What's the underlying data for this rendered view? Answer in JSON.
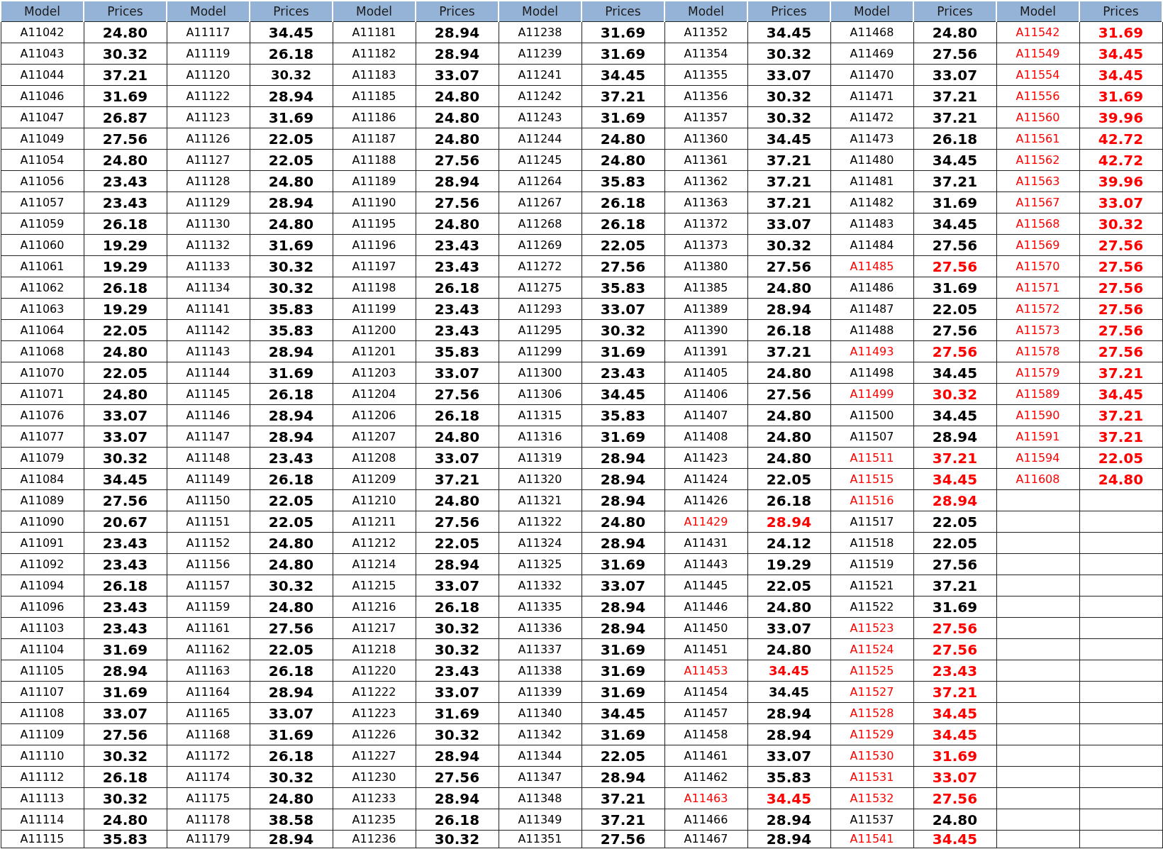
{
  "header": [
    "Model",
    "Prices",
    "Model",
    "Prices",
    "Model",
    "Prices",
    "Model",
    "Prices",
    "Model",
    "Prices",
    "Model",
    "Prices",
    "Model",
    "Prices"
  ],
  "column_groups": [
    {
      "entries": [
        {
          "model": "A11042",
          "price": "24.80",
          "color": "#000000",
          "large": true
        },
        {
          "model": "A11043",
          "price": "30.32",
          "color": "#000000",
          "large": true
        },
        {
          "model": "A11044",
          "price": "37.21",
          "color": "#000000",
          "large": true
        },
        {
          "model": "A11046",
          "price": "31.69",
          "color": "#000000",
          "large": true
        },
        {
          "model": "A11047",
          "price": "26.87",
          "color": "#000000",
          "large": true
        },
        {
          "model": "A11049",
          "price": "27.56",
          "color": "#000000",
          "large": true
        },
        {
          "model": "A11054",
          "price": "24.80",
          "color": "#000000",
          "large": true
        },
        {
          "model": "A11056",
          "price": "23.43",
          "color": "#000000",
          "large": true
        },
        {
          "model": "A11057",
          "price": "23.43",
          "color": "#000000",
          "large": true
        },
        {
          "model": "A11059",
          "price": "26.18",
          "color": "#000000",
          "large": true
        },
        {
          "model": "A11060",
          "price": "19.29",
          "color": "#000000",
          "large": true
        },
        {
          "model": "A11061",
          "price": "19.29",
          "color": "#000000",
          "large": true
        },
        {
          "model": "A11062",
          "price": "26.18",
          "color": "#000000",
          "large": true
        },
        {
          "model": "A11063",
          "price": "19.29",
          "color": "#000000",
          "large": true
        },
        {
          "model": "A11064",
          "price": "22.05",
          "color": "#000000",
          "large": true
        },
        {
          "model": "A11068",
          "price": "24.80",
          "color": "#000000",
          "large": true
        },
        {
          "model": "A11070",
          "price": "22.05",
          "color": "#000000",
          "large": true
        },
        {
          "model": "A11071",
          "price": "24.80",
          "color": "#000000",
          "large": true
        },
        {
          "model": "A11076",
          "price": "33.07",
          "color": "#000000",
          "large": true
        },
        {
          "model": "A11077",
          "price": "33.07",
          "color": "#000000",
          "large": true
        },
        {
          "model": "A11079",
          "price": "30.32",
          "color": "#000000",
          "large": true
        },
        {
          "model": "A11084",
          "price": "34.45",
          "color": "#000000",
          "large": true
        },
        {
          "model": "A11089",
          "price": "27.56",
          "color": "#000000",
          "large": true
        },
        {
          "model": "A11090",
          "price": "20.67",
          "color": "#000000",
          "large": true
        },
        {
          "model": "A11091",
          "price": "23.43",
          "color": "#000000",
          "large": true
        },
        {
          "model": "A11092",
          "price": "23.43",
          "color": "#000000",
          "large": true
        },
        {
          "model": "A11094",
          "price": "26.18",
          "color": "#000000",
          "large": true
        },
        {
          "model": "A11096",
          "price": "23.43",
          "color": "#000000",
          "large": true
        },
        {
          "model": "A11103",
          "price": "23.43",
          "color": "#000000",
          "large": true
        },
        {
          "model": "A11104",
          "price": "31.69",
          "color": "#000000",
          "large": true
        },
        {
          "model": "A11105",
          "price": "28.94",
          "color": "#000000",
          "large": true
        },
        {
          "model": "A11107",
          "price": "31.69",
          "color": "#000000",
          "large": true
        },
        {
          "model": "A11108",
          "price": "33.07",
          "color": "#000000",
          "large": true
        },
        {
          "model": "A11109",
          "price": "27.56",
          "color": "#000000",
          "large": true
        },
        {
          "model": "A11110",
          "price": "30.32",
          "color": "#000000",
          "large": true
        },
        {
          "model": "A11112",
          "price": "26.18",
          "color": "#000000",
          "large": true
        },
        {
          "model": "A11113",
          "price": "30.32",
          "color": "#000000",
          "large": true
        },
        {
          "model": "A11114",
          "price": "24.80",
          "color": "#000000",
          "large": true
        },
        {
          "model": "A11115",
          "price": "35.83",
          "color": "#000000",
          "large": true
        }
      ]
    },
    {
      "entries": [
        {
          "model": "A11117",
          "price": "34.45",
          "color": "#000000",
          "large": true
        },
        {
          "model": "A11119",
          "price": "26.18",
          "color": "#000000",
          "large": true
        },
        {
          "model": "A11120",
          "price": "30.32",
          "color": "#000000",
          "large": false
        },
        {
          "model": "A11122",
          "price": "28.94",
          "color": "#000000",
          "large": true
        },
        {
          "model": "A11123",
          "price": "31.69",
          "color": "#000000",
          "large": true
        },
        {
          "model": "A11126",
          "price": "22.05",
          "color": "#000000",
          "large": true
        },
        {
          "model": "A11127",
          "price": "22.05",
          "color": "#000000",
          "large": true
        },
        {
          "model": "A11128",
          "price": "24.80",
          "color": "#000000",
          "large": true
        },
        {
          "model": "A11129",
          "price": "28.94",
          "color": "#000000",
          "large": true
        },
        {
          "model": "A11130",
          "price": "24.80",
          "color": "#000000",
          "large": true
        },
        {
          "model": "A11132",
          "price": "31.69",
          "color": "#000000",
          "large": true
        },
        {
          "model": "A11133",
          "price": "30.32",
          "color": "#000000",
          "large": true
        },
        {
          "model": "A11134",
          "price": "30.32",
          "color": "#000000",
          "large": true
        },
        {
          "model": "A11141",
          "price": "35.83",
          "color": "#000000",
          "large": true
        },
        {
          "model": "A11142",
          "price": "35.83",
          "color": "#000000",
          "large": true
        },
        {
          "model": "A11143",
          "price": "28.94",
          "color": "#000000",
          "large": true
        },
        {
          "model": "A11144",
          "price": "31.69",
          "color": "#000000",
          "large": true
        },
        {
          "model": "A11145",
          "price": "26.18",
          "color": "#000000",
          "large": true
        },
        {
          "model": "A11146",
          "price": "28.94",
          "color": "#000000",
          "large": true
        },
        {
          "model": "A11147",
          "price": "28.94",
          "color": "#000000",
          "large": true
        },
        {
          "model": "A11148",
          "price": "23.43",
          "color": "#000000",
          "large": true
        },
        {
          "model": "A11149",
          "price": "26.18",
          "color": "#000000",
          "large": true
        },
        {
          "model": "A11150",
          "price": "22.05",
          "color": "#000000",
          "large": true
        },
        {
          "model": "A11151",
          "price": "22.05",
          "color": "#000000",
          "large": true
        },
        {
          "model": "A11152",
          "price": "24.80",
          "color": "#000000",
          "large": true
        },
        {
          "model": "A11156",
          "price": "24.80",
          "color": "#000000",
          "large": true
        },
        {
          "model": "A11157",
          "price": "30.32",
          "color": "#000000",
          "large": true
        },
        {
          "model": "A11159",
          "price": "24.80",
          "color": "#000000",
          "large": true
        },
        {
          "model": "A11161",
          "price": "27.56",
          "color": "#000000",
          "large": true
        },
        {
          "model": "A11162",
          "price": "22.05",
          "color": "#000000",
          "large": true
        },
        {
          "model": "A11163",
          "price": "26.18",
          "color": "#000000",
          "large": true
        },
        {
          "model": "A11164",
          "price": "28.94",
          "color": "#000000",
          "large": true
        },
        {
          "model": "A11165",
          "price": "33.07",
          "color": "#000000",
          "large": true
        },
        {
          "model": "A11168",
          "price": "31.69",
          "color": "#000000",
          "large": true
        },
        {
          "model": "A11172",
          "price": "26.18",
          "color": "#000000",
          "large": true
        },
        {
          "model": "A11174",
          "price": "30.32",
          "color": "#000000",
          "large": true
        },
        {
          "model": "A11175",
          "price": "24.80",
          "color": "#000000",
          "large": true
        },
        {
          "model": "A11178",
          "price": "38.58",
          "color": "#000000",
          "large": true
        },
        {
          "model": "A11179",
          "price": "28.94",
          "color": "#000000",
          "large": true
        }
      ]
    },
    {
      "entries": [
        {
          "model": "A11181",
          "price": "28.94",
          "color": "#000000",
          "large": true
        },
        {
          "model": "A11182",
          "price": "28.94",
          "color": "#000000",
          "large": true
        },
        {
          "model": "A11183",
          "price": "33.07",
          "color": "#000000",
          "large": true
        },
        {
          "model": "A11185",
          "price": "24.80",
          "color": "#000000",
          "large": true
        },
        {
          "model": "A11186",
          "price": "24.80",
          "color": "#000000",
          "large": true
        },
        {
          "model": "A11187",
          "price": "24.80",
          "color": "#000000",
          "large": true
        },
        {
          "model": "A11188",
          "price": "27.56",
          "color": "#000000",
          "large": true
        },
        {
          "model": "A11189",
          "price": "28.94",
          "color": "#000000",
          "large": true
        },
        {
          "model": "A11190",
          "price": "27.56",
          "color": "#000000",
          "large": true
        },
        {
          "model": "A11195",
          "price": "24.80",
          "color": "#000000",
          "large": true
        },
        {
          "model": "A11196",
          "price": "23.43",
          "color": "#000000",
          "large": true
        },
        {
          "model": "A11197",
          "price": "23.43",
          "color": "#000000",
          "large": true
        },
        {
          "model": "A11198",
          "price": "26.18",
          "color": "#000000",
          "large": true
        },
        {
          "model": "A11199",
          "price": "23.43",
          "color": "#000000",
          "large": true
        },
        {
          "model": "A11200",
          "price": "23.43",
          "color": "#000000",
          "large": true
        },
        {
          "model": "A11201",
          "price": "35.83",
          "color": "#000000",
          "large": true
        },
        {
          "model": "A11203",
          "price": "33.07",
          "color": "#000000",
          "large": true
        },
        {
          "model": "A11204",
          "price": "27.56",
          "color": "#000000",
          "large": true
        },
        {
          "model": "A11206",
          "price": "26.18",
          "color": "#000000",
          "large": true
        },
        {
          "model": "A11207",
          "price": "24.80",
          "color": "#000000",
          "large": true
        },
        {
          "model": "A11208",
          "price": "33.07",
          "color": "#000000",
          "large": true
        },
        {
          "model": "A11209",
          "price": "37.21",
          "color": "#000000",
          "large": true
        },
        {
          "model": "A11210",
          "price": "24.80",
          "color": "#000000",
          "large": true
        },
        {
          "model": "A11211",
          "price": "27.56",
          "color": "#000000",
          "large": true
        },
        {
          "model": "A11212",
          "price": "22.05",
          "color": "#000000",
          "large": true
        },
        {
          "model": "A11214",
          "price": "28.94",
          "color": "#000000",
          "large": true
        },
        {
          "model": "A11215",
          "price": "33.07",
          "color": "#000000",
          "large": true
        },
        {
          "model": "A11216",
          "price": "26.18",
          "color": "#000000",
          "large": true
        },
        {
          "model": "A11217",
          "price": "30.32",
          "color": "#000000",
          "large": true
        },
        {
          "model": "A11218",
          "price": "30.32",
          "color": "#000000",
          "large": true
        },
        {
          "model": "A11220",
          "price": "23.43",
          "color": "#000000",
          "large": true
        },
        {
          "model": "A11222",
          "price": "33.07",
          "color": "#000000",
          "large": true
        },
        {
          "model": "A11223",
          "price": "31.69",
          "color": "#000000",
          "large": true
        },
        {
          "model": "A11226",
          "price": "30.32",
          "color": "#000000",
          "large": true
        },
        {
          "model": "A11227",
          "price": "28.94",
          "color": "#000000",
          "large": true
        },
        {
          "model": "A11230",
          "price": "27.56",
          "color": "#000000",
          "large": true
        },
        {
          "model": "A11233",
          "price": "28.94",
          "color": "#000000",
          "large": true
        },
        {
          "model": "A11235",
          "price": "26.18",
          "color": "#000000",
          "large": true
        },
        {
          "model": "A11236",
          "price": "30.32",
          "color": "#000000",
          "large": true
        }
      ]
    },
    {
      "entries": [
        {
          "model": "A11238",
          "price": "31.69",
          "color": "#000000",
          "large": true
        },
        {
          "model": "A11239",
          "price": "31.69",
          "color": "#000000",
          "large": true
        },
        {
          "model": "A11241",
          "price": "34.45",
          "color": "#000000",
          "large": true
        },
        {
          "model": "A11242",
          "price": "37.21",
          "color": "#000000",
          "large": true
        },
        {
          "model": "A11243",
          "price": "31.69",
          "color": "#000000",
          "large": true
        },
        {
          "model": "A11244",
          "price": "24.80",
          "color": "#000000",
          "large": true
        },
        {
          "model": "A11245",
          "price": "24.80",
          "color": "#000000",
          "large": true
        },
        {
          "model": "A11264",
          "price": "35.83",
          "color": "#000000",
          "large": true
        },
        {
          "model": "A11267",
          "price": "26.18",
          "color": "#000000",
          "large": true
        },
        {
          "model": "A11268",
          "price": "26.18",
          "color": "#000000",
          "large": true
        },
        {
          "model": "A11269",
          "price": "22.05",
          "color": "#000000",
          "large": true
        },
        {
          "model": "A11272",
          "price": "27.56",
          "color": "#000000",
          "large": true
        },
        {
          "model": "A11275",
          "price": "35.83",
          "color": "#000000",
          "large": true
        },
        {
          "model": "A11293",
          "price": "33.07",
          "color": "#000000",
          "large": true
        },
        {
          "model": "A11295",
          "price": "30.32",
          "color": "#000000",
          "large": true
        },
        {
          "model": "A11299",
          "price": "31.69",
          "color": "#000000",
          "large": true
        },
        {
          "model": "A11300",
          "price": "23.43",
          "color": "#000000",
          "large": true
        },
        {
          "model": "A11306",
          "price": "34.45",
          "color": "#000000",
          "large": true
        },
        {
          "model": "A11315",
          "price": "35.83",
          "color": "#000000",
          "large": true
        },
        {
          "model": "A11316",
          "price": "31.69",
          "color": "#000000",
          "large": true
        },
        {
          "model": "A11319",
          "price": "28.94",
          "color": "#000000",
          "large": true
        },
        {
          "model": "A11320",
          "price": "28.94",
          "color": "#000000",
          "large": true
        },
        {
          "model": "A11321",
          "price": "28.94",
          "color": "#000000",
          "large": true
        },
        {
          "model": "A11322",
          "price": "24.80",
          "color": "#000000",
          "large": true
        },
        {
          "model": "A11324",
          "price": "28.94",
          "color": "#000000",
          "large": true
        },
        {
          "model": "A11325",
          "price": "31.69",
          "color": "#000000",
          "large": true
        },
        {
          "model": "A11332",
          "price": "33.07",
          "color": "#000000",
          "large": true
        },
        {
          "model": "A11335",
          "price": "28.94",
          "color": "#000000",
          "large": true
        },
        {
          "model": "A11336",
          "price": "28.94",
          "color": "#000000",
          "large": true
        },
        {
          "model": "A11337",
          "price": "31.69",
          "color": "#000000",
          "large": true
        },
        {
          "model": "A11338",
          "price": "31.69",
          "color": "#000000",
          "large": true
        },
        {
          "model": "A11339",
          "price": "31.69",
          "color": "#000000",
          "large": true
        },
        {
          "model": "A11340",
          "price": "34.45",
          "color": "#000000",
          "large": true
        },
        {
          "model": "A11342",
          "price": "31.69",
          "color": "#000000",
          "large": true
        },
        {
          "model": "A11344",
          "price": "22.05",
          "color": "#000000",
          "large": true
        },
        {
          "model": "A11347",
          "price": "28.94",
          "color": "#000000",
          "large": true
        },
        {
          "model": "A11348",
          "price": "37.21",
          "color": "#000000",
          "large": true
        },
        {
          "model": "A11349",
          "price": "37.21",
          "color": "#000000",
          "large": true
        },
        {
          "model": "A11351",
          "price": "27.56",
          "color": "#000000",
          "large": true
        }
      ]
    },
    {
      "entries": [
        {
          "model": "A11352",
          "price": "34.45",
          "color": "#000000",
          "large": true
        },
        {
          "model": "A11354",
          "price": "30.32",
          "color": "#000000",
          "large": true
        },
        {
          "model": "A11355",
          "price": "33.07",
          "color": "#000000",
          "large": true
        },
        {
          "model": "A11356",
          "price": "30.32",
          "color": "#000000",
          "large": true
        },
        {
          "model": "A11357",
          "price": "30.32",
          "color": "#000000",
          "large": true
        },
        {
          "model": "A11360",
          "price": "34.45",
          "color": "#000000",
          "large": true
        },
        {
          "model": "A11361",
          "price": "37.21",
          "color": "#000000",
          "large": true
        },
        {
          "model": "A11362",
          "price": "37.21",
          "color": "#000000",
          "large": true
        },
        {
          "model": "A11363",
          "price": "37.21",
          "color": "#000000",
          "large": true
        },
        {
          "model": "A11372",
          "price": "33.07",
          "color": "#000000",
          "large": true
        },
        {
          "model": "A11373",
          "price": "30.32",
          "color": "#000000",
          "large": true
        },
        {
          "model": "A11380",
          "price": "27.56",
          "color": "#000000",
          "large": true
        },
        {
          "model": "A11385",
          "price": "24.80",
          "color": "#000000",
          "large": true
        },
        {
          "model": "A11389",
          "price": "28.94",
          "color": "#000000",
          "large": true
        },
        {
          "model": "A11390",
          "price": "26.18",
          "color": "#000000",
          "large": true
        },
        {
          "model": "A11391",
          "price": "37.21",
          "color": "#000000",
          "large": true
        },
        {
          "model": "A11405",
          "price": "24.80",
          "color": "#000000",
          "large": true
        },
        {
          "model": "A11406",
          "price": "27.56",
          "color": "#000000",
          "large": true
        },
        {
          "model": "A11407",
          "price": "24.80",
          "color": "#000000",
          "large": true
        },
        {
          "model": "A11408",
          "price": "24.80",
          "color": "#000000",
          "large": true
        },
        {
          "model": "A11423",
          "price": "24.80",
          "color": "#000000",
          "large": true
        },
        {
          "model": "A11424",
          "price": "22.05",
          "color": "#000000",
          "large": true
        },
        {
          "model": "A11426",
          "price": "26.18",
          "color": "#000000",
          "large": true
        },
        {
          "model": "A11429",
          "price": "28.94",
          "color": "#ff0000",
          "large": true
        },
        {
          "model": "A11431",
          "price": "24.12",
          "color": "#000000",
          "large": true
        },
        {
          "model": "A11443",
          "price": "19.29",
          "color": "#000000",
          "large": true
        },
        {
          "model": "A11445",
          "price": "22.05",
          "color": "#000000",
          "large": true
        },
        {
          "model": "A11446",
          "price": "24.80",
          "color": "#000000",
          "large": true
        },
        {
          "model": "A11450",
          "price": "33.07",
          "color": "#000000",
          "large": true
        },
        {
          "model": "A11451",
          "price": "24.80",
          "color": "#000000",
          "large": true
        },
        {
          "model": "A11453",
          "price": "34.45",
          "color": "#ff0000",
          "large": false
        },
        {
          "model": "A11454",
          "price": "34.45",
          "color": "#000000",
          "large": false
        },
        {
          "model": "A11457",
          "price": "28.94",
          "color": "#000000",
          "large": true
        },
        {
          "model": "A11458",
          "price": "28.94",
          "color": "#000000",
          "large": true
        },
        {
          "model": "A11461",
          "price": "33.07",
          "color": "#000000",
          "large": true
        },
        {
          "model": "A11462",
          "price": "35.83",
          "color": "#000000",
          "large": true
        },
        {
          "model": "A11463",
          "price": "34.45",
          "color": "#ff0000",
          "large": true
        },
        {
          "model": "A11466",
          "price": "28.94",
          "color": "#000000",
          "large": true
        },
        {
          "model": "A11467",
          "price": "28.94",
          "color": "#000000",
          "large": true
        }
      ]
    },
    {
      "entries": [
        {
          "model": "A11468",
          "price": "24.80",
          "color": "#000000",
          "large": true
        },
        {
          "model": "A11469",
          "price": "27.56",
          "color": "#000000",
          "large": true
        },
        {
          "model": "A11470",
          "price": "33.07",
          "color": "#000000",
          "large": true
        },
        {
          "model": "A11471",
          "price": "37.21",
          "color": "#000000",
          "large": true
        },
        {
          "model": "A11472",
          "price": "37.21",
          "color": "#000000",
          "large": true
        },
        {
          "model": "A11473",
          "price": "26.18",
          "color": "#000000",
          "large": true
        },
        {
          "model": "A11480",
          "price": "34.45",
          "color": "#000000",
          "large": true
        },
        {
          "model": "A11481",
          "price": "37.21",
          "color": "#000000",
          "large": true
        },
        {
          "model": "A11482",
          "price": "31.69",
          "color": "#000000",
          "large": true
        },
        {
          "model": "A11483",
          "price": "34.45",
          "color": "#000000",
          "large": true
        },
        {
          "model": "A11484",
          "price": "27.56",
          "color": "#000000",
          "large": true
        },
        {
          "model": "A11485",
          "price": "27.56",
          "color": "#ff0000",
          "large": true
        },
        {
          "model": "A11486",
          "price": "31.69",
          "color": "#000000",
          "large": true
        },
        {
          "model": "A11487",
          "price": "22.05",
          "color": "#000000",
          "large": true
        },
        {
          "model": "A11488",
          "price": "27.56",
          "color": "#000000",
          "large": true
        },
        {
          "model": "A11493",
          "price": "27.56",
          "color": "#ff0000",
          "large": true
        },
        {
          "model": "A11498",
          "price": "34.45",
          "color": "#000000",
          "large": true
        },
        {
          "model": "A11499",
          "price": "30.32",
          "color": "#ff0000",
          "large": true
        },
        {
          "model": "A11500",
          "price": "34.45",
          "color": "#000000",
          "large": true
        },
        {
          "model": "A11507",
          "price": "28.94",
          "color": "#000000",
          "large": true
        },
        {
          "model": "A11511",
          "price": "37.21",
          "color": "#ff0000",
          "large": true
        },
        {
          "model": "A11515",
          "price": "34.45",
          "color": "#ff0000",
          "large": true
        },
        {
          "model": "A11516",
          "price": "28.94",
          "color": "#ff0000",
          "large": true
        },
        {
          "model": "A11517",
          "price": "22.05",
          "color": "#000000",
          "large": true
        },
        {
          "model": "A11518",
          "price": "22.05",
          "color": "#000000",
          "large": true
        },
        {
          "model": "A11519",
          "price": "27.56",
          "color": "#000000",
          "large": true
        },
        {
          "model": "A11521",
          "price": "37.21",
          "color": "#000000",
          "large": true
        },
        {
          "model": "A11522",
          "price": "31.69",
          "color": "#000000",
          "large": true
        },
        {
          "model": "A11523",
          "price": "27.56",
          "color": "#ff0000",
          "large": true
        },
        {
          "model": "A11524",
          "price": "27.56",
          "color": "#ff0000",
          "large": true
        },
        {
          "model": "A11525",
          "price": "23.43",
          "color": "#ff0000",
          "large": true
        },
        {
          "model": "A11527",
          "price": "37.21",
          "color": "#ff0000",
          "large": true
        },
        {
          "model": "A11528",
          "price": "34.45",
          "color": "#ff0000",
          "large": true
        },
        {
          "model": "A11529",
          "price": "34.45",
          "color": "#ff0000",
          "large": true
        },
        {
          "model": "A11530",
          "price": "31.69",
          "color": "#ff0000",
          "large": true
        },
        {
          "model": "A11531",
          "price": "33.07",
          "color": "#ff0000",
          "large": true
        },
        {
          "model": "A11532",
          "price": "27.56",
          "color": "#ff0000",
          "large": true
        },
        {
          "model": "A11537",
          "price": "24.80",
          "color": "#000000",
          "large": true
        },
        {
          "model": "A11541",
          "price": "34.45",
          "color": "#ff0000",
          "large": true
        }
      ]
    },
    {
      "entries": [
        {
          "model": "A11542",
          "price": "31.69",
          "color": "#ff0000",
          "large": true
        },
        {
          "model": "A11549",
          "price": "34.45",
          "color": "#ff0000",
          "large": true
        },
        {
          "model": "A11554",
          "price": "34.45",
          "color": "#ff0000",
          "large": true
        },
        {
          "model": "A11556",
          "price": "31.69",
          "color": "#ff0000",
          "large": true
        },
        {
          "model": "A11560",
          "price": "39.96",
          "color": "#ff0000",
          "large": true
        },
        {
          "model": "A11561",
          "price": "42.72",
          "color": "#ff0000",
          "large": true
        },
        {
          "model": "A11562",
          "price": "42.72",
          "color": "#ff0000",
          "large": true
        },
        {
          "model": "A11563",
          "price": "39.96",
          "color": "#ff0000",
          "large": true
        },
        {
          "model": "A11567",
          "price": "33.07",
          "color": "#ff0000",
          "large": true
        },
        {
          "model": "A11568",
          "price": "30.32",
          "color": "#ff0000",
          "large": true
        },
        {
          "model": "A11569",
          "price": "27.56",
          "color": "#ff0000",
          "large": true
        },
        {
          "model": "A11570",
          "price": "27.56",
          "color": "#ff0000",
          "large": true
        },
        {
          "model": "A11571",
          "price": "27.56",
          "color": "#ff0000",
          "large": true
        },
        {
          "model": "A11572",
          "price": "27.56",
          "color": "#ff0000",
          "large": true
        },
        {
          "model": "A11573",
          "price": "27.56",
          "color": "#ff0000",
          "large": true
        },
        {
          "model": "A11578",
          "price": "27.56",
          "color": "#ff0000",
          "large": true
        },
        {
          "model": "A11579",
          "price": "37.21",
          "color": "#ff0000",
          "large": true
        },
        {
          "model": "A11589",
          "price": "34.45",
          "color": "#ff0000",
          "large": true
        },
        {
          "model": "A11590",
          "price": "37.21",
          "color": "#ff0000",
          "large": true
        },
        {
          "model": "A11591",
          "price": "37.21",
          "color": "#ff0000",
          "large": true
        },
        {
          "model": "A11594",
          "price": "22.05",
          "color": "#ff0000",
          "large": true
        },
        {
          "model": "A11608",
          "price": "24.80",
          "color": "#ff0000",
          "large": true
        }
      ]
    }
  ]
}
